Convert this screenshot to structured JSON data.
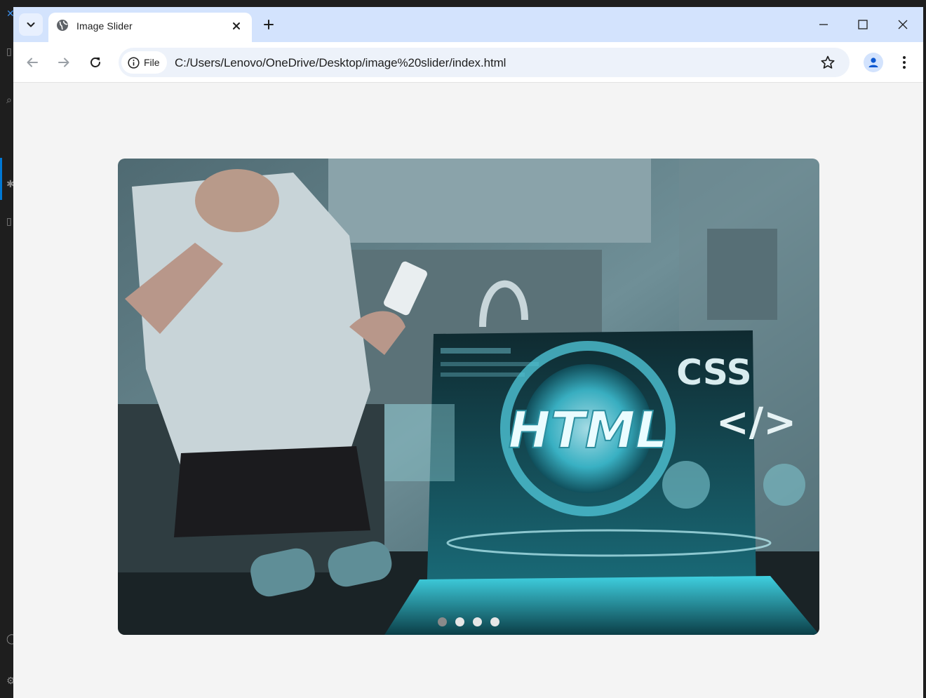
{
  "browser": {
    "tab": {
      "title": "Image Slider",
      "favicon": "globe-icon",
      "close_icon": "close-icon"
    },
    "new_tab_icon": "plus-icon",
    "tab_search_icon": "chevron-down-icon",
    "window_controls": [
      "minimize-icon",
      "maximize-icon",
      "close-icon"
    ],
    "nav": [
      "back-arrow-icon",
      "forward-arrow-icon",
      "reload-icon"
    ],
    "omnibox": {
      "chip_label": "File",
      "chip_icon": "info-icon",
      "url": "C:/Users/Lenovo/OneDrive/Desktop/image%20slider/index.html",
      "bookmark_icon": "star-icon"
    },
    "profile_icon": "person-icon",
    "menu_icon": "three-dots-icon"
  },
  "slider": {
    "image_text": [
      "CSS",
      "</>",
      "HTML"
    ],
    "dot_count": 4,
    "active_index": 0
  },
  "colors": {
    "tabstrip": "#d3e3fd",
    "page_bg": "#f4f4f4",
    "omnibox": "#edf2fa",
    "accent": "#0b57d0",
    "dot_active": "#8a8a8a",
    "dot_inactive": "#e6e6e6"
  }
}
